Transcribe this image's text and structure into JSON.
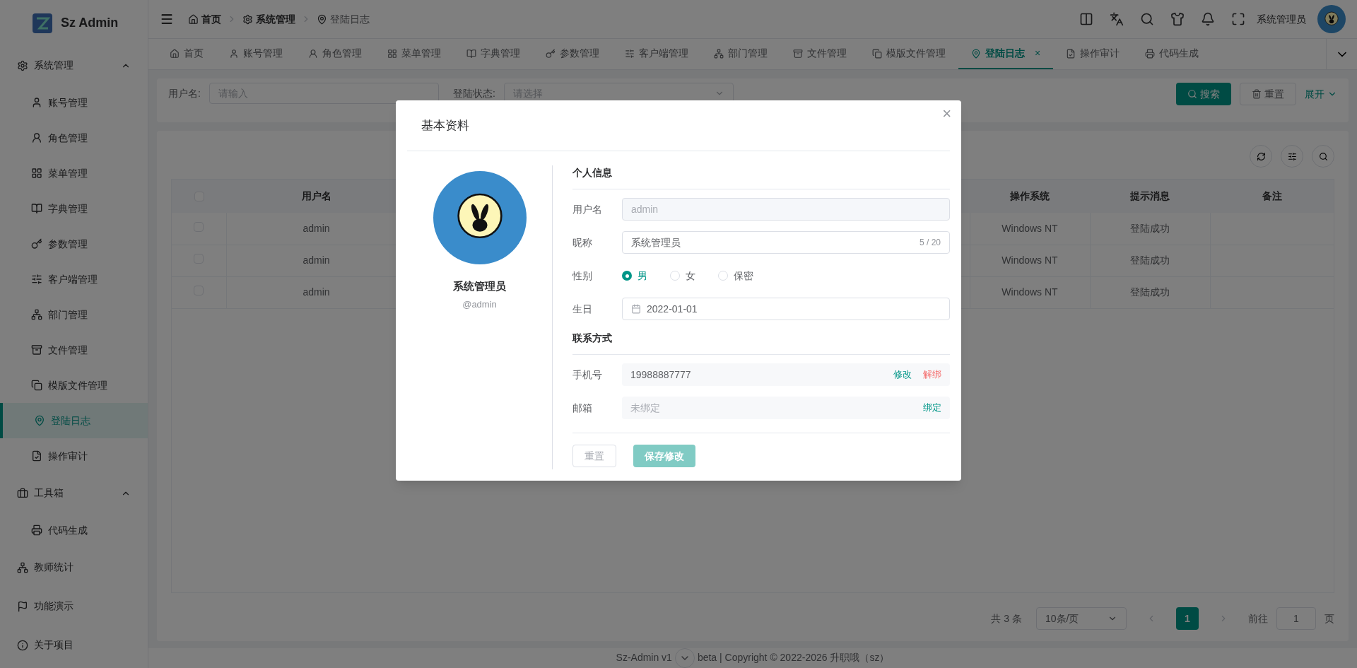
{
  "brand": {
    "name": "Sz Admin"
  },
  "breadcrumb": [
    {
      "label": "首页"
    },
    {
      "label": "系统管理"
    },
    {
      "label": "登陆日志"
    }
  ],
  "header": {
    "user": "系统管理员"
  },
  "sidebar": {
    "items": [
      {
        "label": "系统管理",
        "selected": false,
        "expanded": true,
        "children": [
          {
            "label": "账号管理",
            "selected": false
          },
          {
            "label": "角色管理",
            "selected": false
          },
          {
            "label": "菜单管理",
            "selected": false
          },
          {
            "label": "字典管理",
            "selected": false
          },
          {
            "label": "参数管理",
            "selected": false
          },
          {
            "label": "客户端管理",
            "selected": false
          },
          {
            "label": "部门管理",
            "selected": false
          },
          {
            "label": "文件管理",
            "selected": false
          },
          {
            "label": "模版文件管理",
            "selected": false
          },
          {
            "label": "登陆日志",
            "selected": true
          },
          {
            "label": "操作审计",
            "selected": false
          }
        ]
      },
      {
        "label": "工具箱",
        "selected": false,
        "expanded": true,
        "children": [
          {
            "label": "代码生成",
            "selected": false
          }
        ]
      },
      {
        "label": "教师统计",
        "selected": false
      },
      {
        "label": "功能演示",
        "selected": false
      },
      {
        "label": "关于项目",
        "selected": false
      }
    ]
  },
  "tabs": [
    {
      "label": "首页",
      "selected": false
    },
    {
      "label": "账号管理",
      "selected": false
    },
    {
      "label": "角色管理",
      "selected": false
    },
    {
      "label": "菜单管理",
      "selected": false
    },
    {
      "label": "字典管理",
      "selected": false
    },
    {
      "label": "参数管理",
      "selected": false
    },
    {
      "label": "客户端管理",
      "selected": false
    },
    {
      "label": "部门管理",
      "selected": false
    },
    {
      "label": "文件管理",
      "selected": false
    },
    {
      "label": "模版文件管理",
      "selected": false
    },
    {
      "label": "登陆日志",
      "selected": true,
      "close": "×"
    },
    {
      "label": "操作审计",
      "selected": false
    },
    {
      "label": "代码生成",
      "selected": false
    }
  ],
  "search_form": {
    "fields": [
      {
        "label": "用户名:",
        "placeholder": "请输入",
        "kind": "input"
      },
      {
        "label": "登陆状态:",
        "placeholder": "请选择",
        "kind": "select"
      }
    ],
    "search_button": "搜索",
    "reset_button": "重置",
    "expand_link": "展开"
  },
  "table": {
    "all_checked": false,
    "columns": [
      "用户名",
      "",
      "操作系统",
      "提示消息",
      "备注"
    ],
    "rows": [
      {
        "checked": false,
        "cells": [
          "admin",
          "",
          "Windows NT",
          "登陆成功",
          ""
        ]
      },
      {
        "checked": false,
        "cells": [
          "admin",
          "",
          "Windows NT",
          "登陆成功",
          ""
        ]
      },
      {
        "checked": false,
        "cells": [
          "admin",
          "",
          "Windows NT",
          "登陆成功",
          ""
        ]
      }
    ]
  },
  "pagination": {
    "total": "共 3 条",
    "page_size": "10条/页",
    "pages": [
      {
        "label": "1",
        "selected": true
      }
    ],
    "goto_label": "前往",
    "goto_value": "1",
    "goto_suffix": "页"
  },
  "footer": {
    "text_before": "Sz-Admin v1",
    "text_after": "beta | Copyright © 2022-2026 升职哦（sz）"
  },
  "dialog": {
    "title": "基本资料",
    "close": "×",
    "profile": {
      "name": "系统管理员",
      "handle": "@admin"
    },
    "sections": [
      {
        "title": "个人信息",
        "fields": [
          {
            "kind": "input",
            "label": "用户名",
            "value": "admin",
            "disabled": true
          },
          {
            "kind": "input",
            "label": "昵称",
            "value": "系统管理员",
            "disabled": false,
            "counter": "5 / 20"
          },
          {
            "kind": "radio",
            "label": "性别",
            "options": [
              {
                "label": "男",
                "selected": true
              },
              {
                "label": "女",
                "selected": false
              },
              {
                "label": "保密",
                "selected": false
              }
            ]
          },
          {
            "kind": "date",
            "label": "生日",
            "value": "2022-01-01"
          }
        ]
      },
      {
        "title": "联系方式",
        "fields": [
          {
            "kind": "contact",
            "label": "手机号",
            "value": "19988887777",
            "actions": [
              {
                "label": "修改",
                "kind": "edit"
              },
              {
                "label": "解绑",
                "kind": "danger"
              }
            ]
          },
          {
            "kind": "contact",
            "label": "邮箱",
            "placeholder": "未绑定",
            "actions": [
              {
                "label": "绑定",
                "kind": "edit"
              }
            ]
          }
        ]
      }
    ],
    "reset_button": "重置",
    "save_button": {
      "label": "保存修改",
      "disabled": true
    }
  }
}
